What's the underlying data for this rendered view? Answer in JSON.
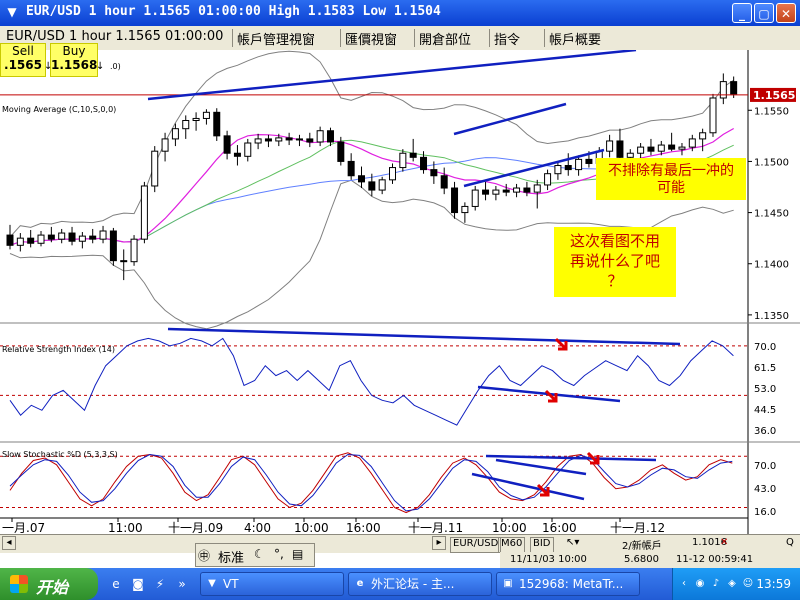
{
  "window": {
    "title": "EUR/USD 1 hour 1.1565 01:00:00 High 1.1583 Low 1.1504",
    "icon": "metatrader-app-icon",
    "minimize": "_",
    "restore": "▢",
    "close": "✕"
  },
  "tabs": {
    "chart_info": "EUR/USD 1 hour 1.1565 01:00:00",
    "items": [
      "帳戶管理視窗",
      "匯價視窗",
      "開倉部位",
      "指令",
      "帳戶概要"
    ]
  },
  "trade": {
    "sell_label": "Sell",
    "sell_price": ".1565",
    "buy_label": "Buy",
    "buy_price": "1.1568",
    "arrow": "↓"
  },
  "chart": {
    "ma_label": "Moving Average (C,10,S,0,0)",
    "trailing_label": ".0)",
    "current_price": "1.1565",
    "rsi_label": "Relative Strength Index (14)",
    "stoch_label": "Slow Stochastic %D (5,3,3,S)",
    "annotation_1": "不排除有最后一冲的\n可能",
    "annotation_2": "这次看图不用\n再说什么了吧\n？",
    "colors": {
      "up_candle": "#ffffff",
      "down_candle": "#000000",
      "bollinger": "#808080",
      "ma_fast": "#e020e0",
      "ma_slow": "#6080ff",
      "trendline": "#1020c0",
      "annotation_arrow": "#e00000",
      "note_bg": "#ffff00",
      "price_line": "#c00000"
    }
  },
  "chart_data": [
    {
      "type": "candlestick",
      "title": "EUR/USD 1 hour",
      "x_ticks": [
        "一月.07",
        "11:00",
        "十一月.09",
        "4:00",
        "10:00",
        "16:00",
        "十一月.11",
        "10:00",
        "16:00",
        "十一月.12"
      ],
      "y_ticks": [
        1.155,
        1.15,
        1.145,
        1.14,
        1.135
      ],
      "ylim": [
        1.1345,
        1.1605
      ],
      "ohlc": [
        [
          1.1428,
          1.1438,
          1.1414,
          1.1418
        ],
        [
          1.1418,
          1.143,
          1.1412,
          1.1425
        ],
        [
          1.1425,
          1.1433,
          1.1416,
          1.142
        ],
        [
          1.142,
          1.1432,
          1.1417,
          1.1428
        ],
        [
          1.1428,
          1.1436,
          1.1421,
          1.1424
        ],
        [
          1.1424,
          1.1434,
          1.142,
          1.143
        ],
        [
          1.143,
          1.1436,
          1.1418,
          1.1422
        ],
        [
          1.1422,
          1.1431,
          1.1415,
          1.1427
        ],
        [
          1.1427,
          1.1434,
          1.142,
          1.1424
        ],
        [
          1.1424,
          1.1437,
          1.142,
          1.1432
        ],
        [
          1.1432,
          1.1435,
          1.1398,
          1.1403
        ],
        [
          1.1403,
          1.1414,
          1.1384,
          1.1402
        ],
        [
          1.1402,
          1.1428,
          1.1398,
          1.1424
        ],
        [
          1.1424,
          1.148,
          1.142,
          1.1476
        ],
        [
          1.1476,
          1.1515,
          1.147,
          1.151
        ],
        [
          1.151,
          1.1528,
          1.15,
          1.1522
        ],
        [
          1.1522,
          1.1537,
          1.1515,
          1.1532
        ],
        [
          1.1532,
          1.1545,
          1.1522,
          1.154
        ],
        [
          1.154,
          1.1548,
          1.153,
          1.1542
        ],
        [
          1.1542,
          1.1551,
          1.1536,
          1.1548
        ],
        [
          1.1548,
          1.1552,
          1.152,
          1.1525
        ],
        [
          1.1525,
          1.153,
          1.1502,
          1.1508
        ],
        [
          1.1508,
          1.1516,
          1.1496,
          1.1505
        ],
        [
          1.1505,
          1.1522,
          1.15,
          1.1518
        ],
        [
          1.1518,
          1.1527,
          1.1512,
          1.1522
        ],
        [
          1.1522,
          1.1526,
          1.1514,
          1.152
        ],
        [
          1.152,
          1.1527,
          1.1515,
          1.1523
        ],
        [
          1.1523,
          1.1528,
          1.1516,
          1.1521
        ],
        [
          1.1521,
          1.1526,
          1.1515,
          1.1522
        ],
        [
          1.1522,
          1.1528,
          1.1514,
          1.1519
        ],
        [
          1.1519,
          1.1534,
          1.1515,
          1.153
        ],
        [
          1.153,
          1.1533,
          1.1515,
          1.1519
        ],
        [
          1.1519,
          1.1524,
          1.1496,
          1.15
        ],
        [
          1.15,
          1.1508,
          1.1482,
          1.1486
        ],
        [
          1.1486,
          1.1495,
          1.1474,
          1.148
        ],
        [
          1.148,
          1.1488,
          1.1466,
          1.1472
        ],
        [
          1.1472,
          1.1485,
          1.1468,
          1.1482
        ],
        [
          1.1482,
          1.1498,
          1.1478,
          1.1494
        ],
        [
          1.1494,
          1.1512,
          1.149,
          1.1508
        ],
        [
          1.1508,
          1.1522,
          1.15,
          1.1504
        ],
        [
          1.1504,
          1.151,
          1.1488,
          1.1492
        ],
        [
          1.1492,
          1.15,
          1.1478,
          1.1486
        ],
        [
          1.1486,
          1.1494,
          1.1468,
          1.1474
        ],
        [
          1.1474,
          1.148,
          1.1444,
          1.145
        ],
        [
          1.145,
          1.146,
          1.144,
          1.1456
        ],
        [
          1.1456,
          1.1476,
          1.1452,
          1.1472
        ],
        [
          1.1472,
          1.148,
          1.1462,
          1.1468
        ],
        [
          1.1468,
          1.1476,
          1.1462,
          1.1472
        ],
        [
          1.1472,
          1.1478,
          1.1466,
          1.147
        ],
        [
          1.147,
          1.1478,
          1.1465,
          1.1474
        ],
        [
          1.1474,
          1.148,
          1.1466,
          1.147
        ],
        [
          1.147,
          1.1482,
          1.1454,
          1.1477
        ],
        [
          1.1477,
          1.1492,
          1.1472,
          1.1488
        ],
        [
          1.1488,
          1.15,
          1.1482,
          1.1496
        ],
        [
          1.1496,
          1.1508,
          1.1486,
          1.1492
        ],
        [
          1.1492,
          1.1506,
          1.1486,
          1.1502
        ],
        [
          1.1502,
          1.151,
          1.1494,
          1.1498
        ],
        [
          1.1498,
          1.1514,
          1.1494,
          1.151
        ],
        [
          1.151,
          1.1526,
          1.1504,
          1.152
        ],
        [
          1.152,
          1.1532,
          1.15,
          1.1504
        ],
        [
          1.1504,
          1.1512,
          1.1496,
          1.1508
        ],
        [
          1.1508,
          1.1518,
          1.1502,
          1.1514
        ],
        [
          1.1514,
          1.1522,
          1.1506,
          1.151
        ],
        [
          1.151,
          1.152,
          1.1506,
          1.1516
        ],
        [
          1.1516,
          1.1528,
          1.151,
          1.1512
        ],
        [
          1.1512,
          1.1518,
          1.1506,
          1.1514
        ],
        [
          1.1514,
          1.1526,
          1.151,
          1.1522
        ],
        [
          1.1522,
          1.1532,
          1.151,
          1.1528
        ],
        [
          1.1528,
          1.1566,
          1.1524,
          1.1562
        ],
        [
          1.1562,
          1.1586,
          1.1556,
          1.1578
        ],
        [
          1.1578,
          1.1583,
          1.1562,
          1.1566
        ]
      ]
    },
    {
      "type": "line",
      "title": "Relative Strength Index (14)",
      "y_ticks": [
        70.0,
        61.5,
        53.0,
        44.5,
        36.0
      ],
      "ylim": [
        32,
        78
      ],
      "levels": [
        70,
        50
      ],
      "values": [
        48,
        42,
        46,
        44,
        50,
        52,
        48,
        44,
        54,
        62,
        66,
        70,
        72,
        73,
        72,
        70,
        71,
        73,
        72,
        70,
        73,
        66,
        54,
        56,
        62,
        58,
        60,
        56,
        60,
        56,
        52,
        62,
        64,
        56,
        50,
        48,
        47,
        50,
        46,
        44,
        42,
        40,
        38,
        45,
        52,
        58,
        62,
        56,
        54,
        58,
        62,
        60,
        56,
        54,
        58,
        61,
        64,
        62,
        60,
        66,
        62,
        56,
        54,
        58,
        64,
        68,
        72,
        70,
        66
      ]
    },
    {
      "type": "line",
      "title": "Slow Stochastic %D (5,3,3,S)",
      "y_ticks": [
        70.0,
        43.0,
        16.0
      ],
      "ylim": [
        10,
        92
      ],
      "levels": [
        80,
        20
      ],
      "series": [
        {
          "values": [
            40,
            60,
            75,
            78,
            70,
            50,
            30,
            22,
            30,
            50,
            68,
            80,
            82,
            78,
            60,
            38,
            28,
            35,
            55,
            76,
            80,
            70,
            50,
            30,
            20,
            25,
            40,
            60,
            80,
            84,
            78,
            60,
            40,
            20,
            14,
            20,
            35,
            55,
            72,
            78,
            70,
            55,
            38,
            30,
            28,
            35,
            50,
            68,
            80,
            82,
            72,
            55,
            42,
            44,
            52,
            64,
            70,
            60,
            52,
            56,
            70,
            76,
            72
          ]
        },
        {
          "values": [
            45,
            58,
            70,
            76,
            74,
            58,
            38,
            26,
            28,
            42,
            60,
            75,
            82,
            80,
            68,
            46,
            32,
            32,
            48,
            68,
            79,
            76,
            58,
            38,
            24,
            22,
            34,
            52,
            72,
            82,
            81,
            68,
            48,
            28,
            16,
            18,
            30,
            48,
            66,
            76,
            74,
            62,
            44,
            34,
            29,
            32,
            44,
            60,
            75,
            81,
            77,
            62,
            48,
            44,
            48,
            58,
            66,
            64,
            56,
            54,
            64,
            72,
            74
          ]
        }
      ]
    }
  ],
  "statusbar": {
    "sym": "EUR/USD",
    "period": "M60",
    "side": "BID",
    "val": "1.1016",
    "page": "2/新帳戶",
    "date": "11/11/03 10:00",
    "value": "5.6800",
    "datetime": "11-12 00:59:41",
    "q": "Q"
  },
  "toolbar": {
    "label": "标准"
  },
  "taskbar": {
    "start": "开始",
    "tasks": [
      "VT",
      "外汇论坛 - 主...",
      "152968: MetaTr..."
    ],
    "clock": "13:59"
  }
}
